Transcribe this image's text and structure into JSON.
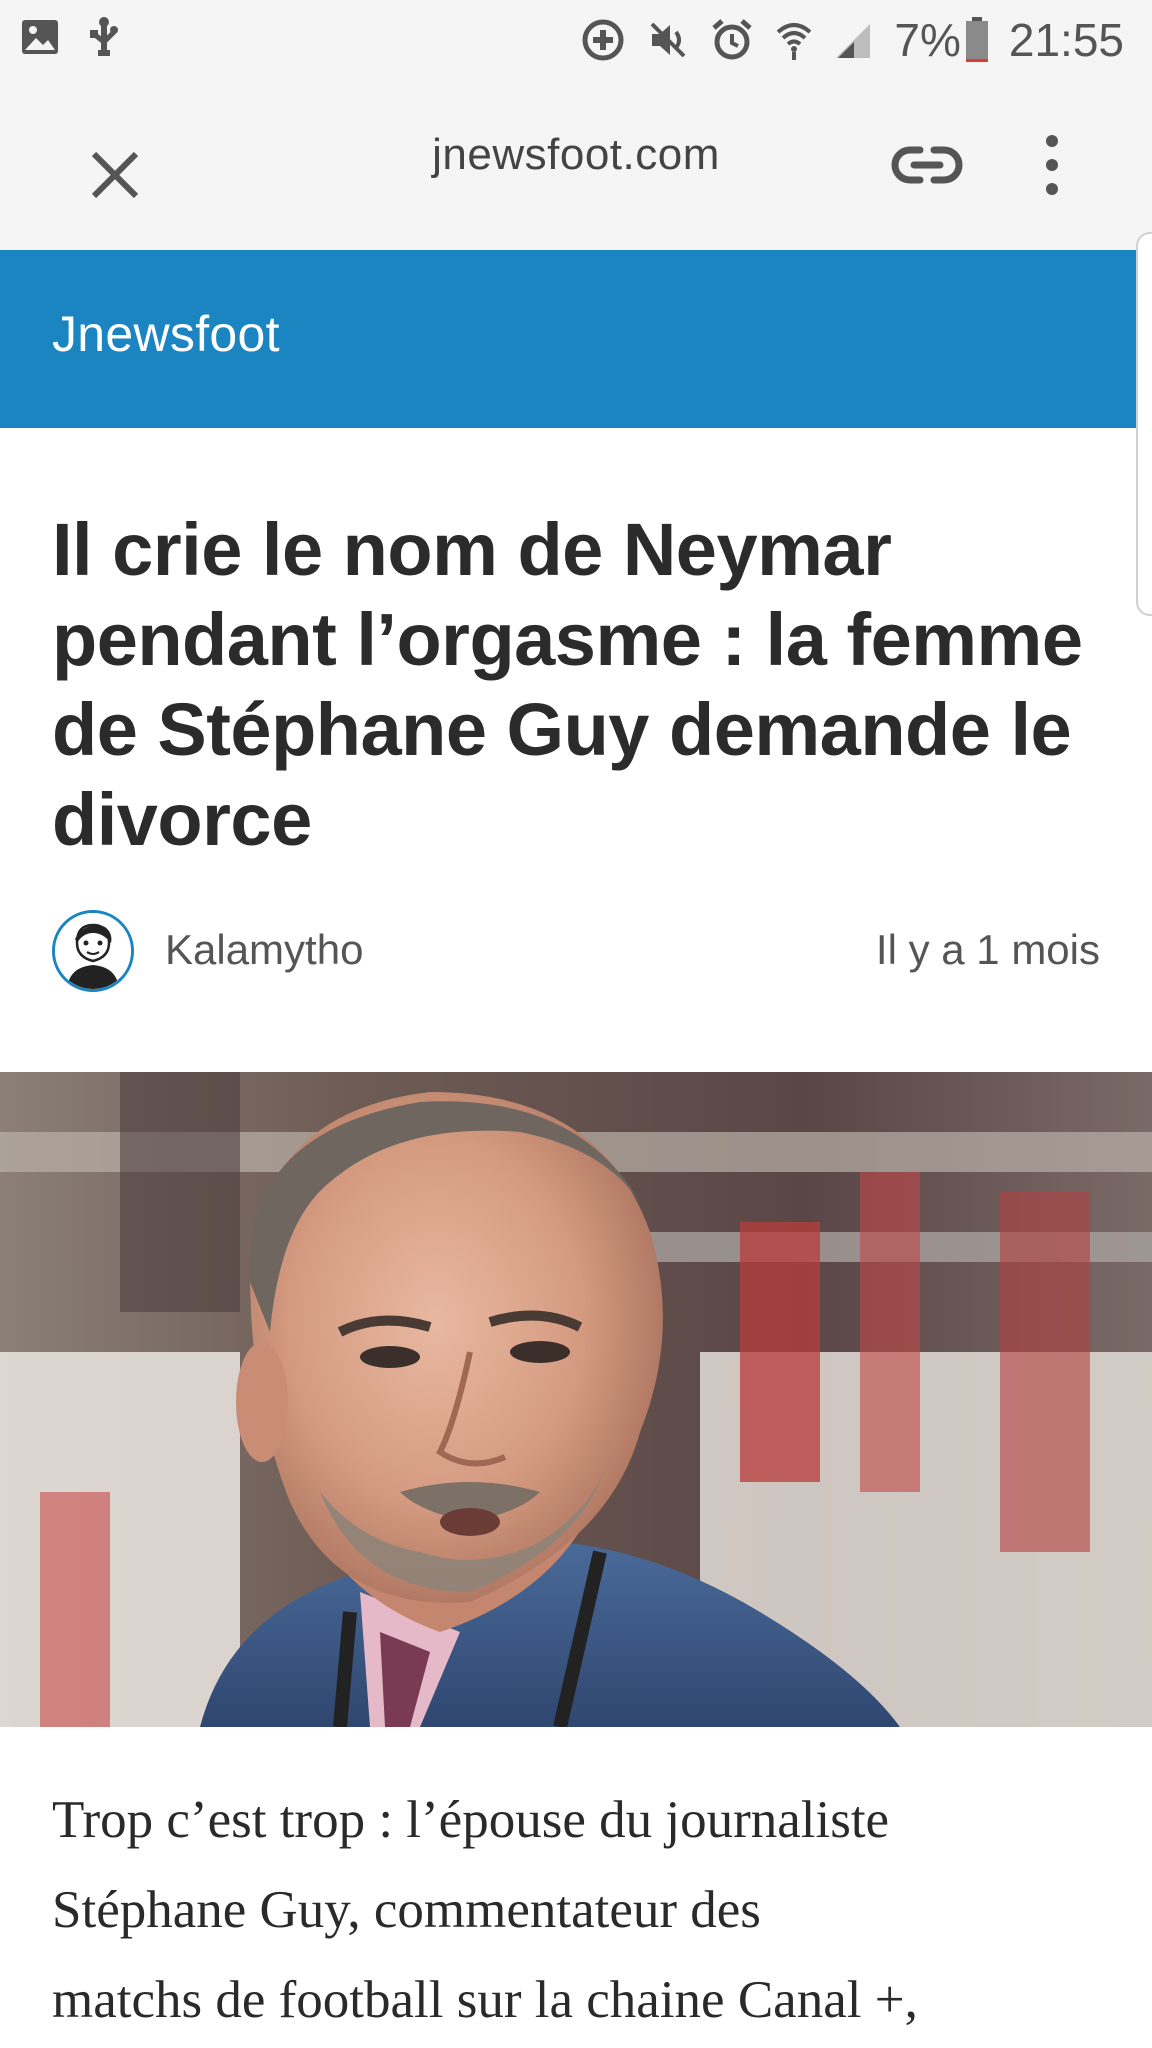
{
  "status_bar": {
    "left_icons": [
      "image-icon",
      "usb-debug-icon"
    ],
    "right_icons": [
      "data-saver-icon",
      "mute-icon",
      "alarm-icon",
      "wifi-icon",
      "signal-icon"
    ],
    "battery_percent": "7%",
    "battery_level": 0.07,
    "time": "21:55"
  },
  "toolbar": {
    "domain": "jnewsfoot.com",
    "icons": [
      "close-icon",
      "link-icon",
      "more-vertical-icon"
    ]
  },
  "site": {
    "name": "Jnewsfoot",
    "brand_color": "#1a85c1"
  },
  "article": {
    "headline": "Il crie le nom de Neymar pendant l’orgasme : la femme de Stéphane Guy demande le divorce",
    "author": "Kalamytho",
    "date": "Il y a 1 mois",
    "body_lines": [
      "Trop c’est trop : l’épouse du journaliste",
      "Stéphane Guy, commentateur des",
      "matchs de football sur la chaine Canal +,"
    ]
  }
}
